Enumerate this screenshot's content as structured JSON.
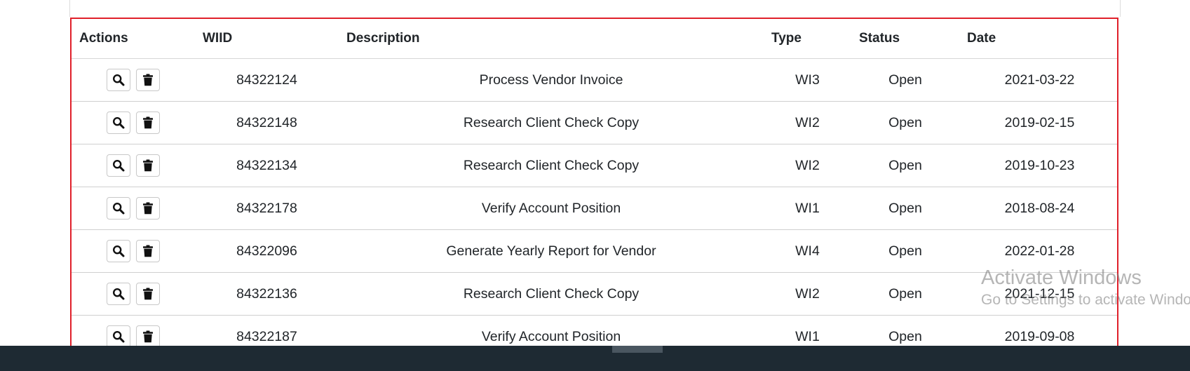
{
  "table": {
    "headers": {
      "actions": "Actions",
      "wiid": "WIID",
      "description": "Description",
      "type": "Type",
      "status": "Status",
      "date": "Date"
    },
    "rows": [
      {
        "wiid": "84322124",
        "description": "Process Vendor Invoice",
        "type": "WI3",
        "status": "Open",
        "date": "2021-03-22"
      },
      {
        "wiid": "84322148",
        "description": "Research Client Check Copy",
        "type": "WI2",
        "status": "Open",
        "date": "2019-02-15"
      },
      {
        "wiid": "84322134",
        "description": "Research Client Check Copy",
        "type": "WI2",
        "status": "Open",
        "date": "2019-10-23"
      },
      {
        "wiid": "84322178",
        "description": "Verify Account Position",
        "type": "WI1",
        "status": "Open",
        "date": "2018-08-24"
      },
      {
        "wiid": "84322096",
        "description": "Generate Yearly Report for Vendor",
        "type": "WI4",
        "status": "Open",
        "date": "2022-01-28"
      },
      {
        "wiid": "84322136",
        "description": "Research Client Check Copy",
        "type": "WI2",
        "status": "Open",
        "date": "2021-12-15"
      },
      {
        "wiid": "84322187",
        "description": "Verify Account Position",
        "type": "WI1",
        "status": "Open",
        "date": "2019-09-08"
      }
    ]
  },
  "icons": {
    "view": "search-icon",
    "delete": "trash-icon"
  },
  "watermark": {
    "title": "Activate Windows",
    "subtitle": "Go to Settings to activate Windows."
  },
  "colors": {
    "highlight_border": "#e0202a",
    "taskbar": "#1e2a33"
  }
}
